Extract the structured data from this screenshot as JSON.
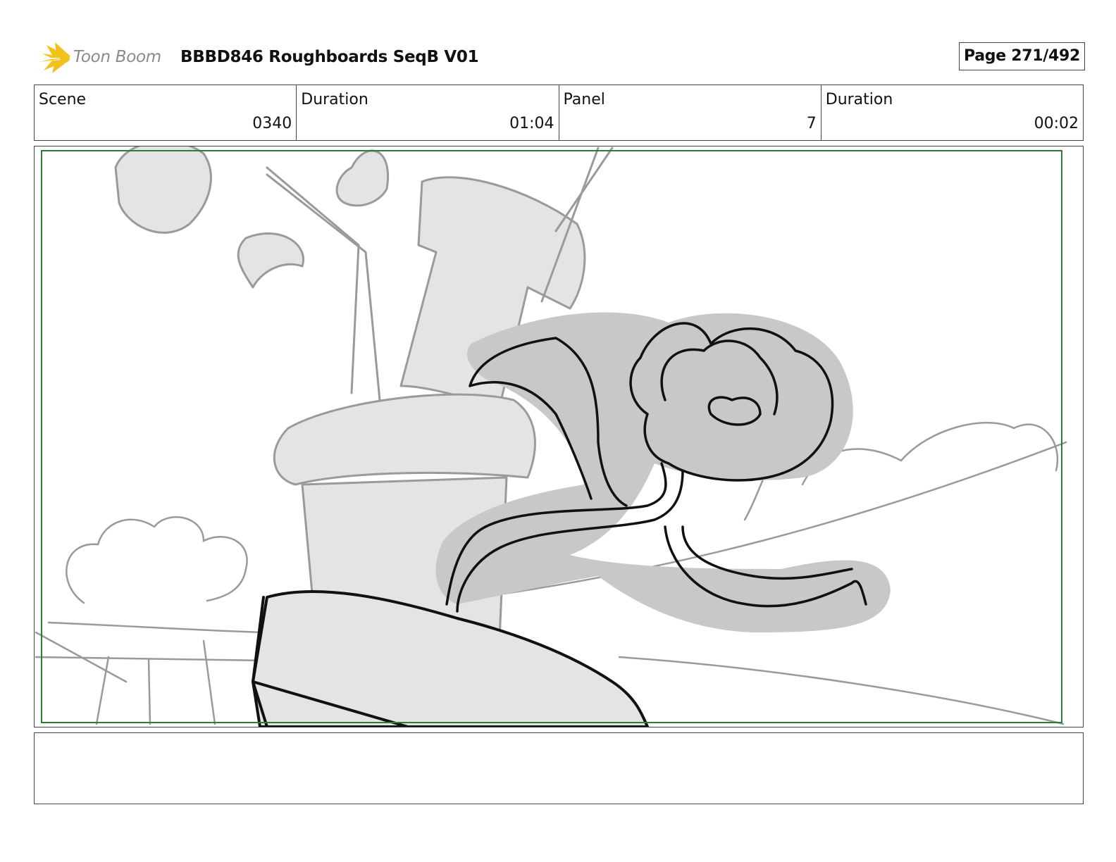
{
  "header": {
    "logo_text": "Toon Boom",
    "title": "BBBD846 Roughboards SeqB V01",
    "page": "Page 271/492"
  },
  "info": {
    "scene_label": "Scene",
    "scene_value": "0340",
    "scene_duration_label": "Duration",
    "scene_duration_value": "01:04",
    "panel_label": "Panel",
    "panel_value": "7",
    "panel_duration_label": "Duration",
    "panel_duration_value": "00:02"
  },
  "notes": {
    "text": ""
  },
  "colors": {
    "logo_yellow": "#f2c21b",
    "safe_area_green": "#2e7d32",
    "sketch_fill_light": "#e4e4e4",
    "sketch_fill_mid": "#c8c8c8",
    "sketch_line_gray": "#9a9a9a",
    "sketch_line_black": "#111111"
  }
}
